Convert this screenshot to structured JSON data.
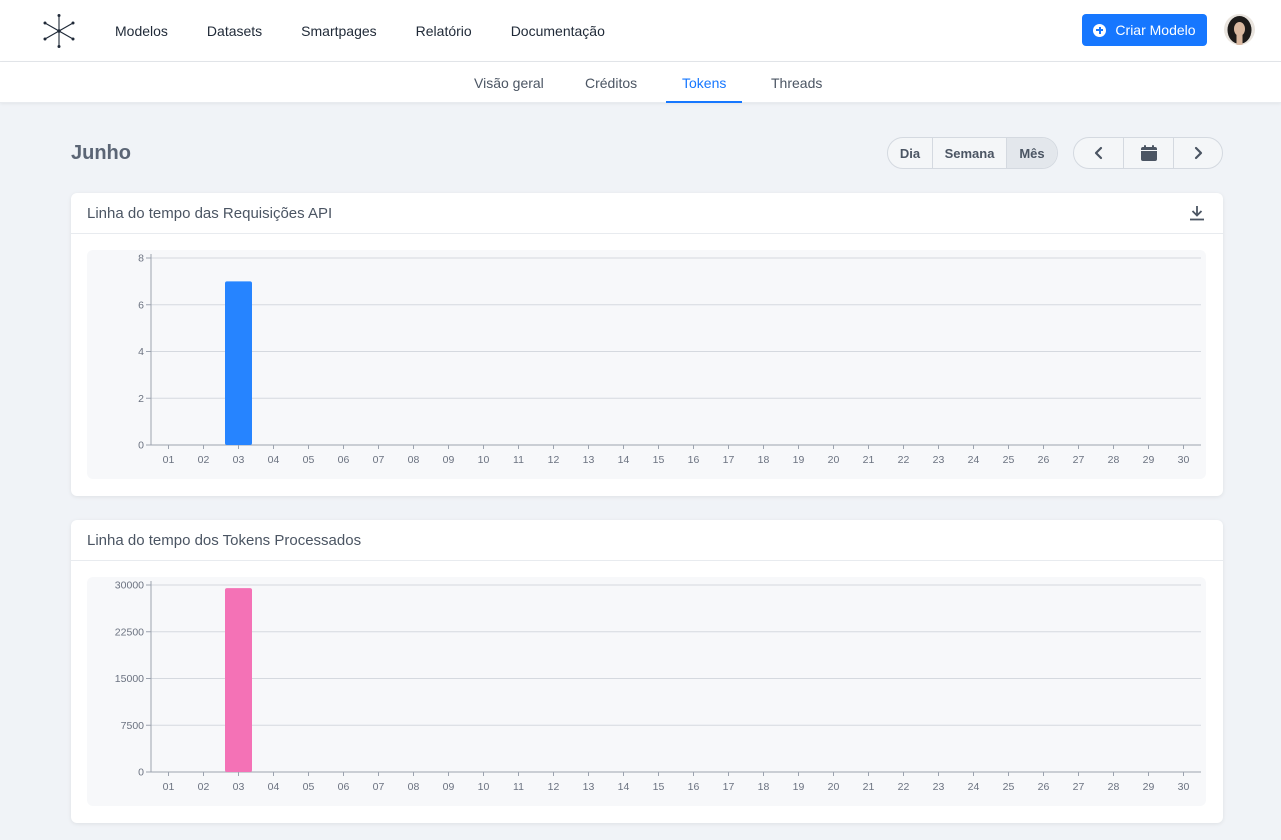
{
  "nav": {
    "links": [
      "Modelos",
      "Datasets",
      "Smartpages",
      "Relatório",
      "Documentação"
    ],
    "create_label": "Criar Modelo"
  },
  "subnav": {
    "tabs": [
      "Visão geral",
      "Créditos",
      "Tokens",
      "Threads"
    ],
    "active": "Tokens"
  },
  "period": {
    "title": "Junho",
    "options": [
      "Dia",
      "Semana",
      "Mês"
    ],
    "active": "Mês"
  },
  "cards": [
    {
      "title": "Linha do tempo das Requisições API"
    },
    {
      "title": "Linha do tempo dos Tokens Processados"
    }
  ],
  "chart_data": [
    {
      "type": "bar",
      "title": "Linha do tempo das Requisições API",
      "categories": [
        "01",
        "02",
        "03",
        "04",
        "05",
        "06",
        "07",
        "08",
        "09",
        "10",
        "11",
        "12",
        "13",
        "14",
        "15",
        "16",
        "17",
        "18",
        "19",
        "20",
        "21",
        "22",
        "23",
        "24",
        "25",
        "26",
        "27",
        "28",
        "29",
        "30"
      ],
      "values": [
        0,
        0,
        7,
        0,
        0,
        0,
        0,
        0,
        0,
        0,
        0,
        0,
        0,
        0,
        0,
        0,
        0,
        0,
        0,
        0,
        0,
        0,
        0,
        0,
        0,
        0,
        0,
        0,
        0,
        0
      ],
      "yticks": [
        0,
        2,
        4,
        6,
        8
      ],
      "ylim": [
        0,
        8
      ],
      "color": "#2684ff",
      "grid": true
    },
    {
      "type": "bar",
      "title": "Linha do tempo dos Tokens Processados",
      "categories": [
        "01",
        "02",
        "03",
        "04",
        "05",
        "06",
        "07",
        "08",
        "09",
        "10",
        "11",
        "12",
        "13",
        "14",
        "15",
        "16",
        "17",
        "18",
        "19",
        "20",
        "21",
        "22",
        "23",
        "24",
        "25",
        "26",
        "27",
        "28",
        "29",
        "30"
      ],
      "values": [
        0,
        0,
        29500,
        0,
        0,
        0,
        0,
        0,
        0,
        0,
        0,
        0,
        0,
        0,
        0,
        0,
        0,
        0,
        0,
        0,
        0,
        0,
        0,
        0,
        0,
        0,
        0,
        0,
        0,
        0
      ],
      "yticks": [
        0,
        7500,
        15000,
        22500,
        30000
      ],
      "ylim": [
        0,
        30000
      ],
      "color": "#f472b6",
      "grid": true
    }
  ]
}
